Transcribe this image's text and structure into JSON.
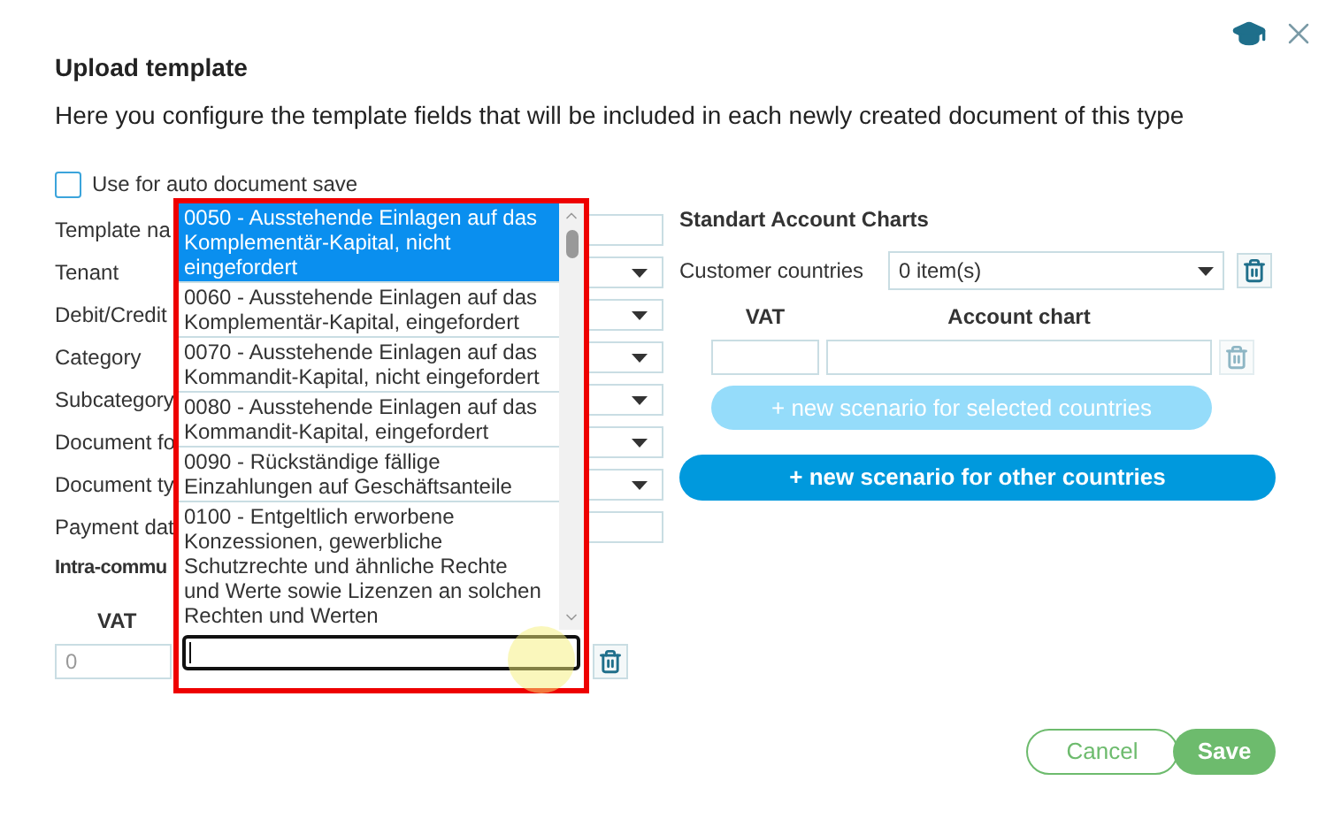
{
  "dialog": {
    "title": "Upload template",
    "description": "Here you configure the template fields that will be included in each newly created document of this type"
  },
  "auto_save": {
    "label": "Use for auto document save",
    "checked": false
  },
  "form_rows": [
    {
      "label": "Template na",
      "kind": "text"
    },
    {
      "label": "Tenant",
      "kind": "select"
    },
    {
      "label": "Debit/Credit",
      "kind": "select"
    },
    {
      "label": "Category",
      "kind": "select"
    },
    {
      "label": "Subcategory",
      "kind": "select"
    },
    {
      "label": "Document fo",
      "kind": "select"
    },
    {
      "label": "Document ty",
      "kind": "select"
    },
    {
      "label": "Payment dat",
      "kind": "text"
    }
  ],
  "intra_community": {
    "title": "Intra-commu",
    "vat_header": "VAT",
    "vat_value": "0"
  },
  "account_charts": {
    "title": "Standart Account Charts",
    "countries_label": "Customer countries",
    "countries_value": "0 item(s)",
    "vat_header": "VAT",
    "chart_header": "Account chart",
    "selected_button": "+ new scenario for selected countries",
    "other_button": "+ new scenario for other countries"
  },
  "dropdown": {
    "options": [
      {
        "label": "0050 - Ausstehende Einlagen auf das Komplementär-Kapital, nicht eingefordert",
        "selected": true
      },
      {
        "label": "0060 - Ausstehende Einlagen auf das Komplementär-Kapital, eingefordert",
        "selected": false
      },
      {
        "label": "0070 - Ausstehende Einlagen auf das Kommandit-Kapital, nicht eingefordert",
        "selected": false
      },
      {
        "label": "0080 - Ausstehende Einlagen auf das Kommandit-Kapital, eingefordert",
        "selected": false
      },
      {
        "label": "0090 - Rückständige fällige Einzahlungen auf Geschäftsanteile",
        "selected": false
      },
      {
        "label": "0100 - Entgeltlich erworbene Konzessionen, gewerbliche Schutzrechte und ähnliche Rechte und Werte sowie Lizenzen an solchen Rechten und Werten",
        "selected": false
      }
    ]
  },
  "buttons": {
    "cancel": "Cancel",
    "save": "Save"
  }
}
